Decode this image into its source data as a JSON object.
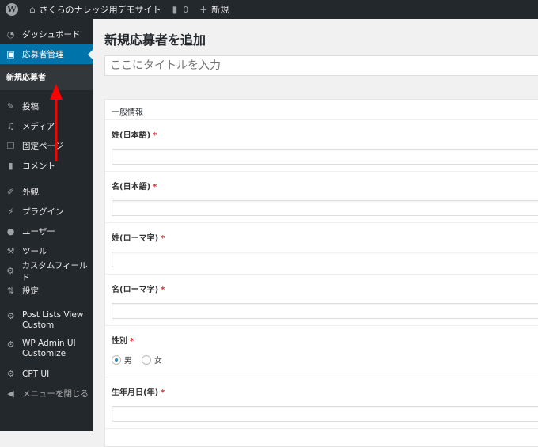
{
  "adminbar": {
    "site_name": "さくらのナレッジ用デモサイト",
    "comments_count": "0",
    "new_label": "新規"
  },
  "sidebar": {
    "items": [
      {
        "label": "ダッシュボード",
        "icon": "dashboard-icon"
      },
      {
        "label": "応募者管理",
        "icon": "media-icon",
        "active": true
      },
      {
        "label": "投稿",
        "icon": "pin-icon"
      },
      {
        "label": "メディア",
        "icon": "media-library-icon"
      },
      {
        "label": "固定ページ",
        "icon": "pages-icon"
      },
      {
        "label": "コメント",
        "icon": "comment-icon"
      },
      {
        "label": "外観",
        "icon": "paintbrush-icon"
      },
      {
        "label": "プラグイン",
        "icon": "plugin-icon"
      },
      {
        "label": "ユーザー",
        "icon": "user-icon"
      },
      {
        "label": "ツール",
        "icon": "wrench-icon"
      },
      {
        "label": "カスタムフィールド",
        "icon": "gear-icon"
      },
      {
        "label": "設定",
        "icon": "settings-icon"
      },
      {
        "label": "Post Lists View Custom",
        "icon": "gear-icon"
      },
      {
        "label": "WP Admin UI Customize",
        "icon": "gear-icon"
      },
      {
        "label": "CPT UI",
        "icon": "gear-icon"
      },
      {
        "label": "メニューを閉じる",
        "icon": "collapse-icon"
      }
    ],
    "submenu": [
      "新規応募者"
    ]
  },
  "main": {
    "page_title": "新規応募者を追加",
    "title_placeholder": "ここにタイトルを入力",
    "postbox_title": "一般情報",
    "fields": [
      {
        "label": "姓(日本語)",
        "required": "*",
        "value": ""
      },
      {
        "label": "名(日本語)",
        "required": "*",
        "value": ""
      },
      {
        "label": "姓(ローマ字)",
        "required": "*",
        "value": ""
      },
      {
        "label": "名(ローマ字)",
        "required": "*",
        "value": ""
      },
      {
        "label": "性別",
        "required": "*",
        "options": [
          "男",
          "女"
        ],
        "selected": "男"
      },
      {
        "label": "生年月日(年)",
        "required": "*",
        "value": ""
      }
    ]
  },
  "colors": {
    "accent": "#0073aa",
    "adminbar_bg": "#23282d",
    "required": "#dc3232",
    "annotation_arrow": "#ff0000"
  }
}
